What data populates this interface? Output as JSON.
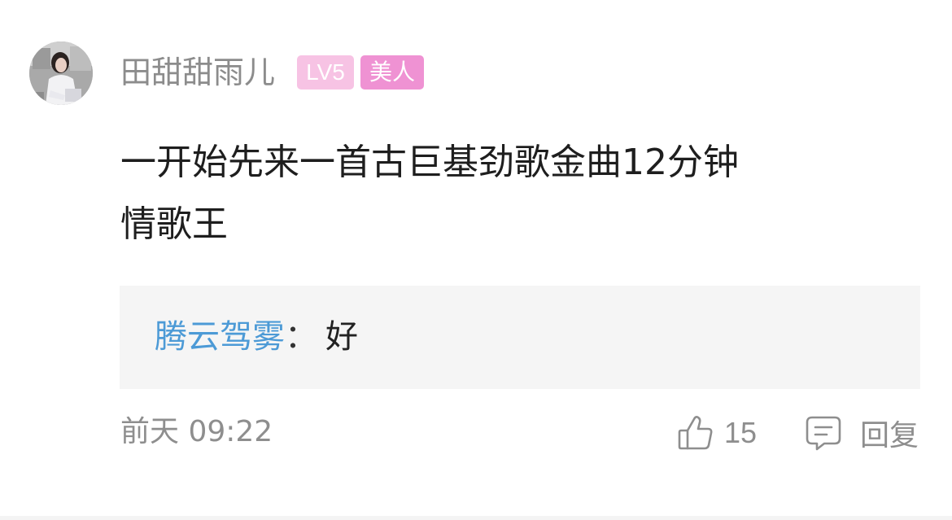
{
  "comment": {
    "avatar_icon": "user-avatar-photo",
    "username": "田甜甜雨儿",
    "level_badge": "LV5",
    "title_badge": "美人",
    "content_line1": "一开始先来一首古巨基劲歌金曲12分钟",
    "content_line2": "情歌王",
    "reply": {
      "author": "腾云驾雾",
      "separator": "：",
      "text": "好"
    },
    "time": "前天 09:22",
    "like_icon": "thumbs-up-icon",
    "like_count": "15",
    "reply_icon": "comment-bubble-icon",
    "reply_label": "回复"
  },
  "colors": {
    "username": "#8c8c8c",
    "level_badge_bg": "#f7c3e4",
    "title_badge_bg": "#ef92d3",
    "reply_author": "#4c9ad6",
    "reply_box_bg": "#f5f5f5",
    "meta_text": "#8e8e8e"
  }
}
